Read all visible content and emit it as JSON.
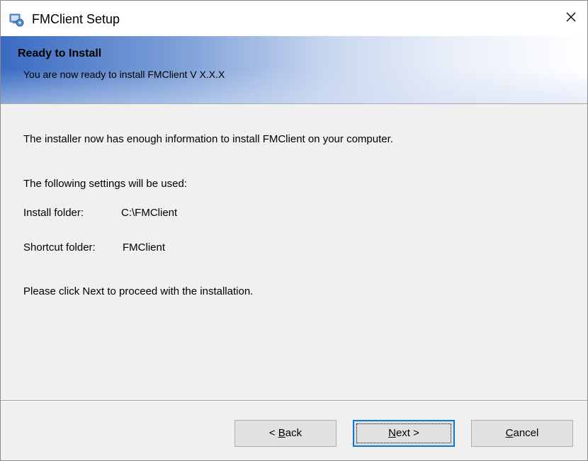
{
  "window": {
    "title": "FMClient Setup",
    "close_glyph": "✕"
  },
  "banner": {
    "title": "Ready to Install",
    "subtitle": "You are now ready to install FMClient V X.X.X"
  },
  "content": {
    "intro": "The installer now has enough information to install FMClient on your computer.",
    "settings_intro": "The following settings will be used:",
    "install_folder_label": "Install folder:",
    "install_folder_value": "C:\\FMClient",
    "shortcut_folder_label": "Shortcut folder:",
    "shortcut_folder_value": "FMClient",
    "instruction": "Please click Next to proceed with the installation."
  },
  "buttons": {
    "back": {
      "mnemonic": "B",
      "rest": "ack",
      "prefix": "< "
    },
    "next": {
      "mnemonic": "N",
      "rest": "ext >"
    },
    "cancel": {
      "mnemonic": "C",
      "rest": "ancel"
    }
  },
  "icons": {
    "app": "installer-package-icon",
    "close": "close-icon"
  }
}
